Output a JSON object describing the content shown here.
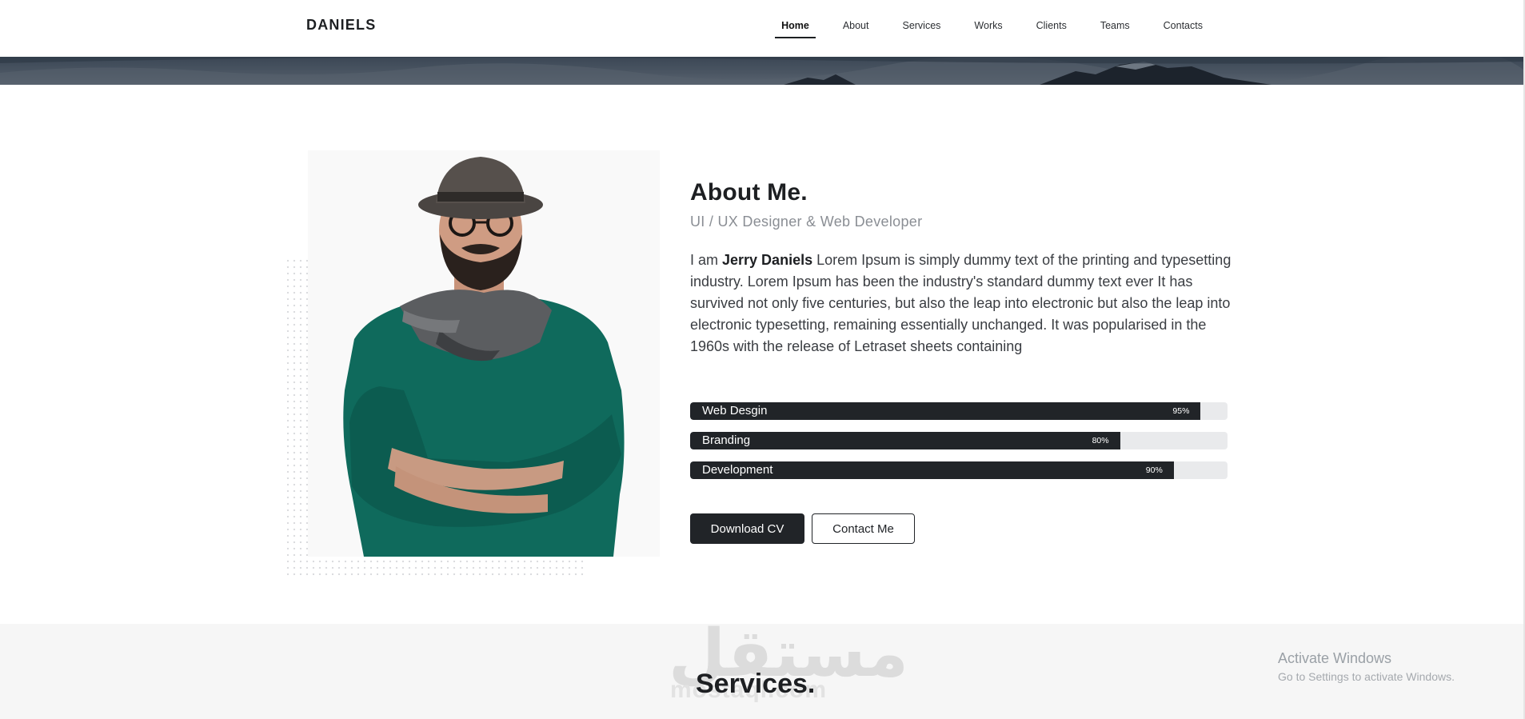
{
  "brand": "DANIELS",
  "nav": [
    {
      "label": "Home",
      "active": true
    },
    {
      "label": "About",
      "active": false
    },
    {
      "label": "Services",
      "active": false
    },
    {
      "label": "Works",
      "active": false
    },
    {
      "label": "Clients",
      "active": false
    },
    {
      "label": "Teams",
      "active": false
    },
    {
      "label": "Contacts",
      "active": false
    }
  ],
  "about": {
    "title": "About Me.",
    "subtitle": "UI / UX Designer & Web Developer",
    "intro_prefix": "I am ",
    "name": "Jerry Daniels",
    "body": " Lorem Ipsum is simply dummy text of the printing and typesetting industry. Lorem Ipsum has been the industry's standard dummy text ever It has survived not only five centuries, but also the leap into electronic but also the leap into electronic typesetting, remaining essentially unchanged. It was popularised in the 1960s with the release of Letraset sheets containing",
    "skills": [
      {
        "label": "Web Desgin",
        "percent_text": "95%",
        "value": 95
      },
      {
        "label": "Branding",
        "percent_text": "80%",
        "value": 80
      },
      {
        "label": "Development",
        "percent_text": "90%",
        "value": 90
      }
    ],
    "download_label": "Download CV",
    "contact_label": "Contact Me"
  },
  "services": {
    "title": "Services.",
    "watermark": "مستقل",
    "watermark_sub": "mostaql.com"
  },
  "os_notice": {
    "title": "Activate Windows",
    "subtitle": "Go to Settings to activate Windows."
  },
  "colors": {
    "dark": "#212428",
    "track": "#e9eaec",
    "muted": "#8a8e94"
  }
}
